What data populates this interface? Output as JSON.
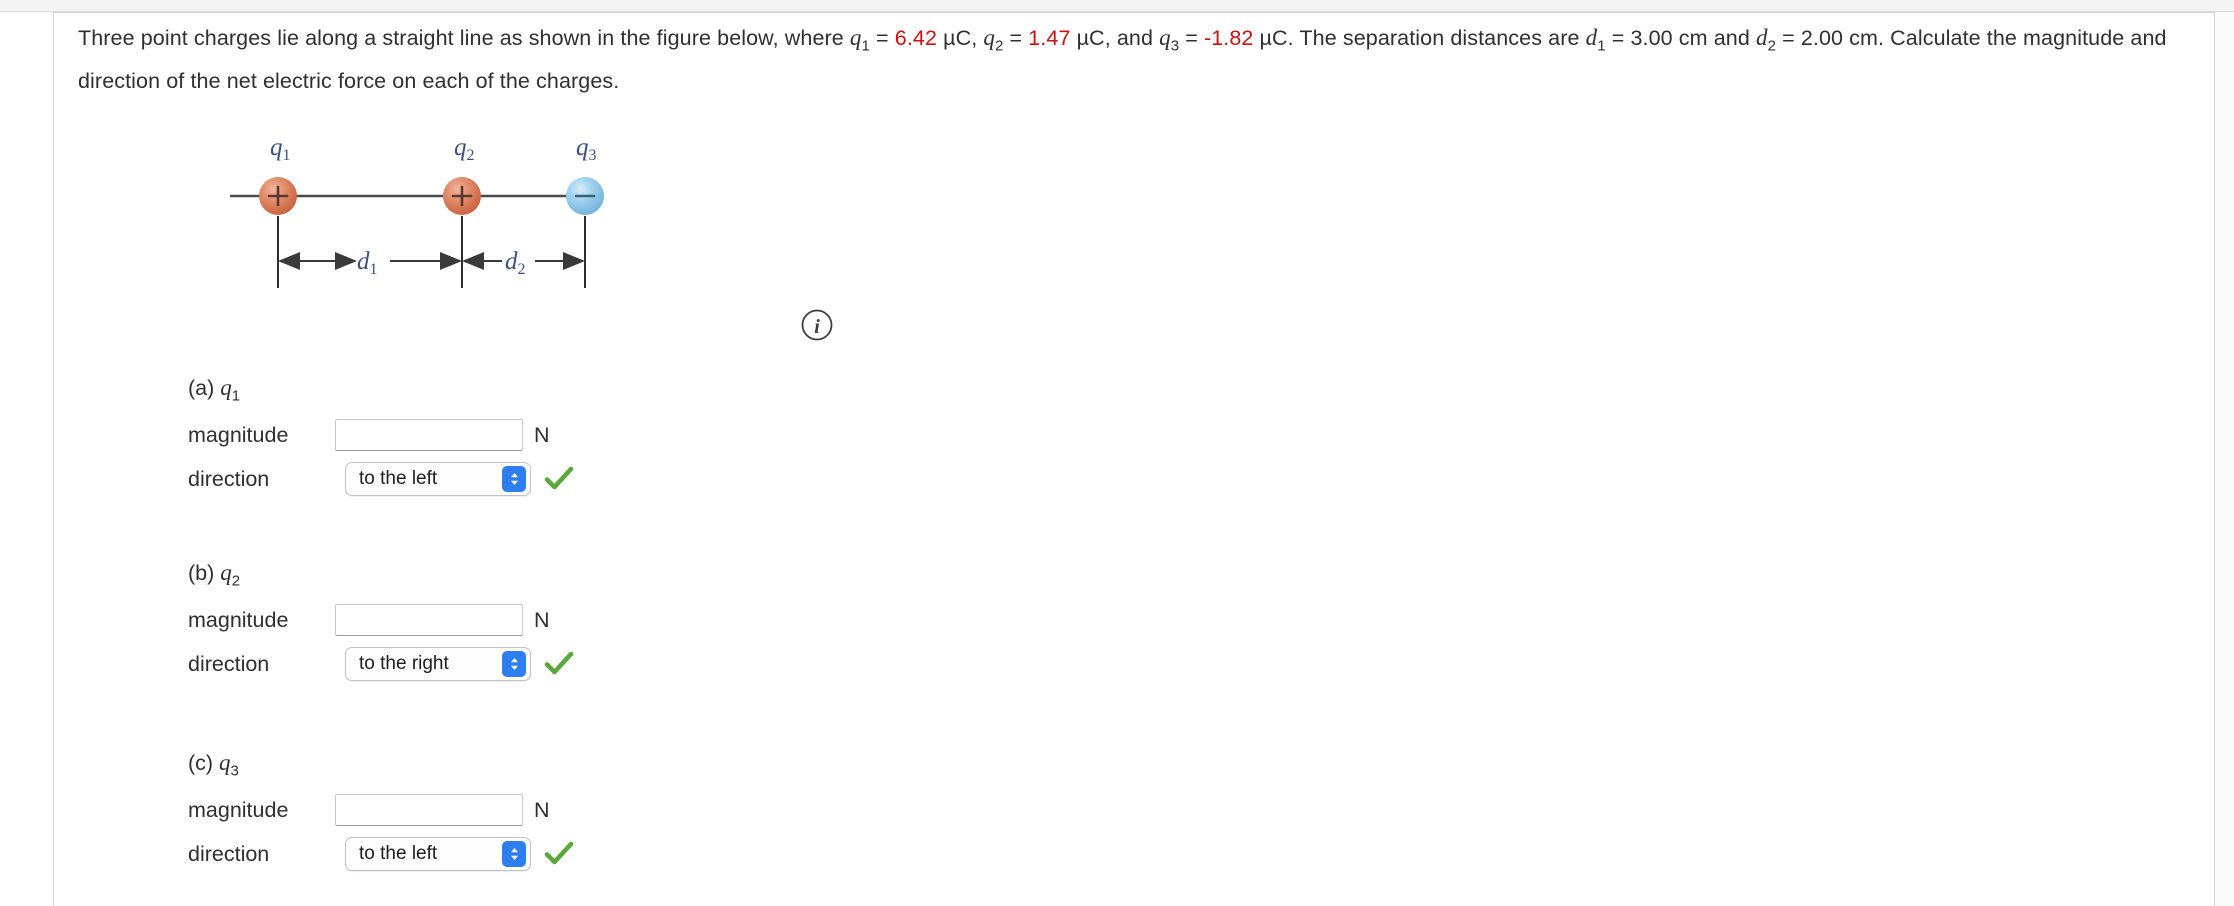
{
  "problem": {
    "sentence1_part1": "Three point charges lie along a straight line as shown in the figure below, where ",
    "q1_symbol": "q",
    "q1_sub": "1",
    "eq1": " = ",
    "q1_value": "6.42",
    "unit1": " µC, ",
    "q2_symbol": "q",
    "q2_sub": "2",
    "eq2": " = ",
    "q2_value": "1.47",
    "unit2": " µC, and ",
    "q3_symbol": "q",
    "q3_sub": "3",
    "eq3": " = ",
    "q3_value": "-1.82",
    "unit3": " µC. The separation distances are ",
    "d1_symbol": "d",
    "d1_sub": "1",
    "eq4": " = ",
    "d1_value": "3.00 cm",
    "conj": " and ",
    "d2_symbol": "d",
    "d2_sub": "2",
    "eq5": " = ",
    "d2_value": "2.00 cm",
    "tail": ". Calculate the magnitude and direction of the net electric force on each of the charges."
  },
  "figure": {
    "charge1_label": "q",
    "charge1_sub": "1",
    "charge1_sign": "+",
    "charge1_color": "#d9714f",
    "charge2_label": "q",
    "charge2_sub": "2",
    "charge2_sign": "+",
    "charge2_color": "#d9714f",
    "charge3_label": "q",
    "charge3_sub": "3",
    "charge3_sign": "−",
    "charge3_color": "#7fbde4",
    "dim1_label": "d",
    "dim1_sub": "1",
    "dim2_label": "d",
    "dim2_sub": "2",
    "label_color": "#3b4f87"
  },
  "info_icon": {
    "glyph": "i"
  },
  "answers": [
    {
      "id": "a",
      "title_prefix": "(a) ",
      "title_symbol": "q",
      "title_sub": "1",
      "magnitude_label": "magnitude",
      "magnitude_value": "",
      "magnitude_placeholder": "",
      "unit": "N",
      "direction_label": "direction",
      "direction_value": "to the left",
      "direction_options": [
        "to the left",
        "to the right"
      ],
      "status": "correct"
    },
    {
      "id": "b",
      "title_prefix": "(b) ",
      "title_symbol": "q",
      "title_sub": "2",
      "magnitude_label": "magnitude",
      "magnitude_value": "",
      "magnitude_placeholder": "",
      "unit": "N",
      "direction_label": "direction",
      "direction_value": "to the right",
      "direction_options": [
        "to the left",
        "to the right"
      ],
      "status": "correct"
    },
    {
      "id": "c",
      "title_prefix": "(c) ",
      "title_symbol": "q",
      "title_sub": "3",
      "magnitude_label": "magnitude",
      "magnitude_value": "",
      "magnitude_placeholder": "",
      "unit": "N",
      "direction_label": "direction",
      "direction_value": "to the left",
      "direction_options": [
        "to the left",
        "to the right"
      ],
      "status": "correct"
    }
  ],
  "colors": {
    "red_value": "#cc1111",
    "check_green": "#5aa83c",
    "stepper_blue": "#2d7ff0",
    "positive_charge": "#d9714f",
    "negative_charge": "#7fbde4"
  }
}
